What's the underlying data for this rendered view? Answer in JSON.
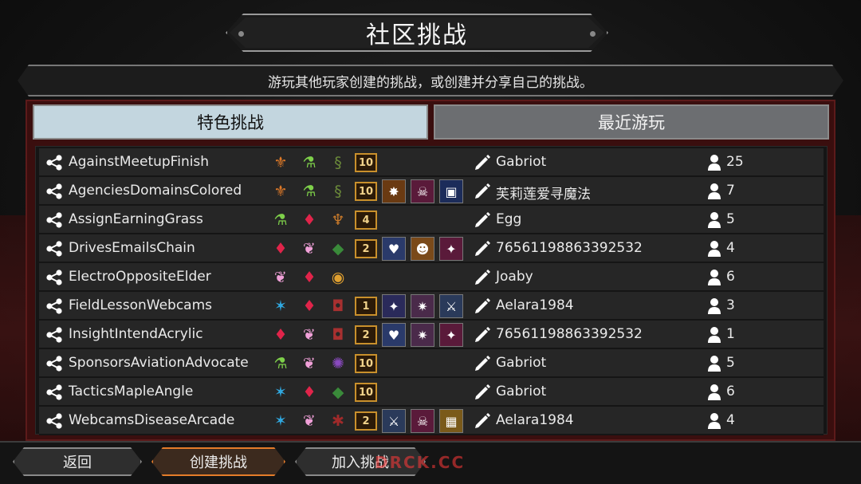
{
  "title": "社区挑战",
  "subtitle": "游玩其他玩家创建的挑战，或创建并分享自己的挑战。",
  "tabs": {
    "featured": "特色挑战",
    "recent": "最近游玩"
  },
  "colors": {
    "tab_active": "#c3d6df",
    "tab_inactive": "#6c6e71",
    "panel_bg": "#3a0e0e",
    "row_bg": "#262626",
    "level_badge_border": "#c9902c",
    "create_button_glow": "#e47c2a",
    "watermark": "#ff3a3a"
  },
  "rows": [
    {
      "name": "AgainstMeetupFinish",
      "mods": [
        {
          "icon": "orange-wings-icon",
          "glyph": "⚜",
          "color": "#e07a28"
        },
        {
          "icon": "green-flask-icon",
          "glyph": "⚗",
          "color": "#7ed04a"
        },
        {
          "icon": "green-serpent-icon",
          "glyph": "§",
          "color": "#6b8a3a"
        }
      ],
      "level": "10",
      "cards": [],
      "author": "Gabriot",
      "players": "25"
    },
    {
      "name": "AgenciesDomainsColored",
      "mods": [
        {
          "icon": "orange-wings-icon",
          "glyph": "⚜",
          "color": "#e07a28"
        },
        {
          "icon": "green-flask-icon",
          "glyph": "⚗",
          "color": "#7ed04a"
        },
        {
          "icon": "green-serpent-icon",
          "glyph": "§",
          "color": "#6b8a3a"
        }
      ],
      "level": "10",
      "cards": [
        {
          "icon": "fire-burst-card-icon",
          "glyph": "✸",
          "bg": "#6a3a12"
        },
        {
          "icon": "purple-skull-card-icon",
          "glyph": "☠",
          "bg": "#5a1a3a"
        },
        {
          "icon": "blue-relic-card-icon",
          "glyph": "▣",
          "bg": "#1c2c5a"
        }
      ],
      "author": "芙莉莲爱寻魔法",
      "players": "7"
    },
    {
      "name": "AssignEarningGrass",
      "mods": [
        {
          "icon": "green-flask-icon",
          "glyph": "⚗",
          "color": "#7ed04a"
        },
        {
          "icon": "red-crest-icon",
          "glyph": "♦",
          "color": "#e0244a"
        },
        {
          "icon": "orange-totem-icon",
          "glyph": "♆",
          "color": "#c97a2a"
        }
      ],
      "level": "4",
      "cards": [],
      "author": "Egg",
      "players": "5"
    },
    {
      "name": "DrivesEmailsChain",
      "mods": [
        {
          "icon": "red-crest-icon",
          "glyph": "♦",
          "color": "#e0244a"
        },
        {
          "icon": "pink-wings-icon",
          "glyph": "❦",
          "color": "#f0a0d8"
        },
        {
          "icon": "green-crystal-icon",
          "glyph": "◆",
          "color": "#3a8a3a"
        }
      ],
      "level": "2",
      "cards": [
        {
          "icon": "red-heart-card-icon",
          "glyph": "♥",
          "bg": "#2a3a6a"
        },
        {
          "icon": "ogre-face-card-icon",
          "glyph": "☻",
          "bg": "#7a4a1a"
        },
        {
          "icon": "crow-card-icon",
          "glyph": "✦",
          "bg": "#5a1a3a"
        }
      ],
      "author": "76561198863392532",
      "players": "4"
    },
    {
      "name": "ElectroOppositeElder",
      "mods": [
        {
          "icon": "pink-wings-icon",
          "glyph": "❦",
          "color": "#f0a0d8"
        },
        {
          "icon": "red-crest-icon",
          "glyph": "♦",
          "color": "#e0244a"
        },
        {
          "icon": "amber-lantern-icon",
          "glyph": "◉",
          "color": "#e0a030"
        }
      ],
      "level": "",
      "cards": [],
      "author": "Joaby",
      "players": "6"
    },
    {
      "name": "FieldLessonWebcams",
      "mods": [
        {
          "icon": "blue-sprite-icon",
          "glyph": "✶",
          "color": "#30a8e0"
        },
        {
          "icon": "red-crest-icon",
          "glyph": "♦",
          "color": "#e0244a"
        },
        {
          "icon": "red-lantern-icon",
          "glyph": "◘",
          "color": "#a83030"
        }
      ],
      "level": "1",
      "cards": [
        {
          "icon": "crow-card-icon",
          "glyph": "✦",
          "bg": "#2a2a5a"
        },
        {
          "icon": "purple-claw-card-icon",
          "glyph": "✷",
          "bg": "#4a2a4a"
        },
        {
          "icon": "blue-axe-card-icon",
          "glyph": "⚔",
          "bg": "#2a3a5a"
        }
      ],
      "author": "Aelara1984",
      "players": "3"
    },
    {
      "name": "InsightIntendAcrylic",
      "mods": [
        {
          "icon": "red-crest-icon",
          "glyph": "♦",
          "color": "#e0244a"
        },
        {
          "icon": "pink-wings-icon",
          "glyph": "❦",
          "color": "#f0a0d8"
        },
        {
          "icon": "red-lantern-icon",
          "glyph": "◘",
          "color": "#a83030"
        }
      ],
      "level": "2",
      "cards": [
        {
          "icon": "red-heart-card-icon",
          "glyph": "♥",
          "bg": "#2a3a6a"
        },
        {
          "icon": "purple-claw-card-icon",
          "glyph": "✷",
          "bg": "#4a2a4a"
        },
        {
          "icon": "crow-card-icon",
          "glyph": "✦",
          "bg": "#5a1a3a"
        }
      ],
      "author": "76561198863392532",
      "players": "1"
    },
    {
      "name": "SponsorsAviationAdvocate",
      "mods": [
        {
          "icon": "green-flask-icon",
          "glyph": "⚗",
          "color": "#7ed04a"
        },
        {
          "icon": "pink-wings-icon",
          "glyph": "❦",
          "color": "#f0a0d8"
        },
        {
          "icon": "purple-spiral-icon",
          "glyph": "✺",
          "color": "#8a4ac0"
        }
      ],
      "level": "10",
      "cards": [],
      "author": "Gabriot",
      "players": "5"
    },
    {
      "name": "TacticsMapleAngle",
      "mods": [
        {
          "icon": "blue-sprite-icon",
          "glyph": "✶",
          "color": "#30a8e0"
        },
        {
          "icon": "red-crest-icon",
          "glyph": "♦",
          "color": "#e0244a"
        },
        {
          "icon": "green-crystal-icon",
          "glyph": "◆",
          "color": "#3a8a3a"
        }
      ],
      "level": "10",
      "cards": [],
      "author": "Gabriot",
      "players": "6"
    },
    {
      "name": "WebcamsDiseaseArcade",
      "mods": [
        {
          "icon": "blue-sprite-icon",
          "glyph": "✶",
          "color": "#30a8e0"
        },
        {
          "icon": "pink-wings-icon",
          "glyph": "❦",
          "color": "#f0a0d8"
        },
        {
          "icon": "red-spider-icon",
          "glyph": "✱",
          "color": "#a02a2a"
        }
      ],
      "level": "2",
      "cards": [
        {
          "icon": "blue-axe-card-icon",
          "glyph": "⚔",
          "bg": "#2a3a5a"
        },
        {
          "icon": "purple-skull-card-icon",
          "glyph": "☠",
          "bg": "#5a1a3a"
        },
        {
          "icon": "gold-chest-card-icon",
          "glyph": "▦",
          "bg": "#7a5a1a"
        }
      ],
      "author": "Aelara1984",
      "players": "4"
    }
  ],
  "footer": {
    "back": "返回",
    "create": "创建挑战",
    "join": "加入挑战"
  },
  "watermark": "DRCK.CC"
}
